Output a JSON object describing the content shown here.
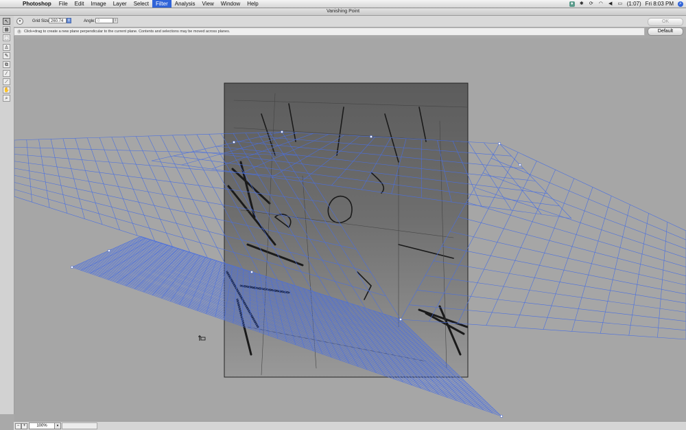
{
  "menubar": {
    "apple_glyph": "",
    "app_name": "Photoshop",
    "menus": [
      "File",
      "Edit",
      "Image",
      "Layer",
      "Select",
      "Filter",
      "Analysis",
      "View",
      "Window",
      "Help"
    ],
    "active_menu": "Filter",
    "battery_text": "(1:07)",
    "clock": "Fri 8:03 PM"
  },
  "window": {
    "title": "Vanishing Point"
  },
  "options": {
    "grid_size_label": "Grid Size:",
    "grid_size_value": "260.74",
    "angle_label": "Angle:",
    "angle_value": "0"
  },
  "buttons": {
    "ok": "OK",
    "default": "Default"
  },
  "hint": {
    "text": "Click+drag to create a new plane perpendicular to the current plane. Contents and selections may be moved across planes."
  },
  "tools": [
    "edit-plane-tool",
    "create-plane-tool",
    "marquee-tool",
    "stamp-tool",
    "brush-tool",
    "transform-tool",
    "eyedropper-tool",
    "measure-tool",
    "hand-tool",
    "zoom-tool"
  ],
  "status": {
    "zoom": "100%"
  },
  "colors": {
    "grid": "#4a6fe0",
    "menu_active": "#2f63d8",
    "canvas": "#a6a6a6"
  }
}
